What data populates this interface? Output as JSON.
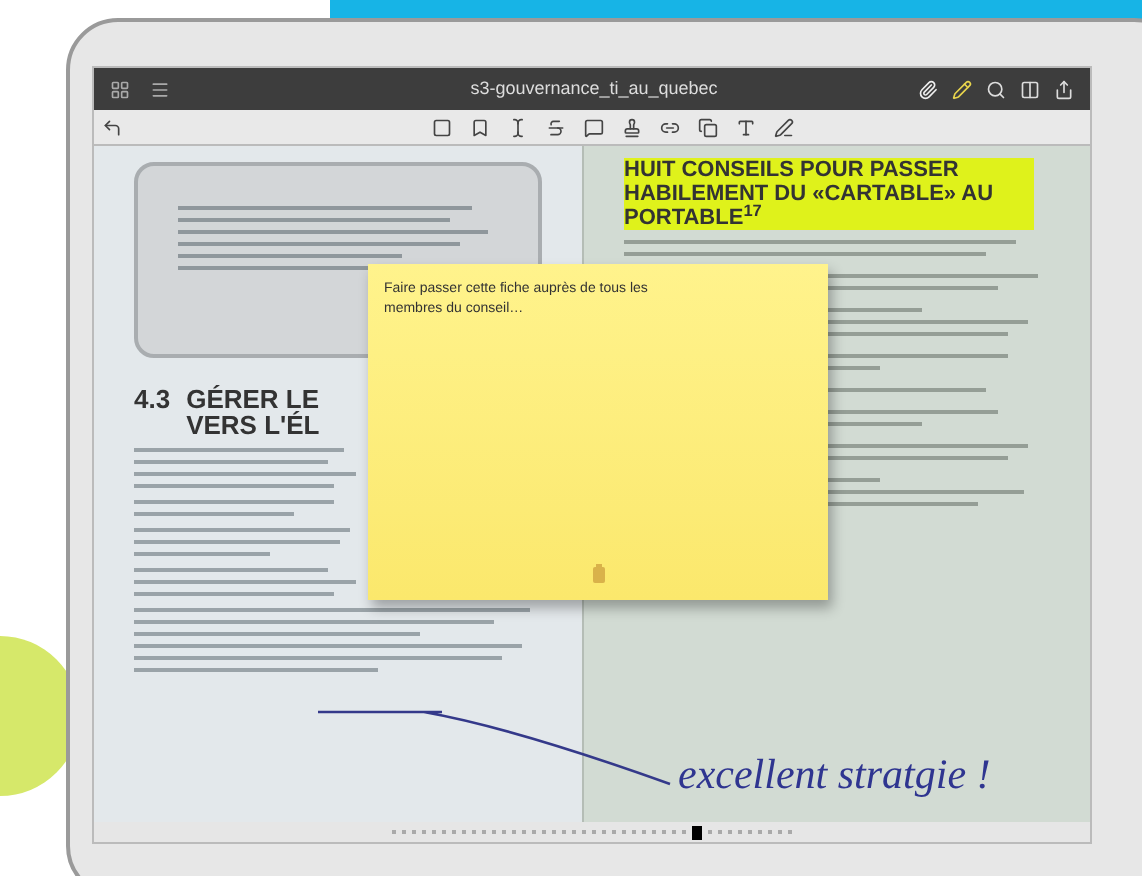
{
  "app_bar": {
    "title": "s3-gouvernance_ti_au_quebec"
  },
  "left_page": {
    "heading_number": "4.3",
    "heading_lines": [
      "GÉRER LE",
      "VERS L'ÉL"
    ]
  },
  "right_page": {
    "heading": "HUIT CONSEILS POUR PASSER HABILEMENT DU «CARTABLE» AU PORTABLE$^{17}$"
  },
  "sticky_note": {
    "text": "Faire passer cette fiche auprès de tous les membres du conseil…"
  },
  "handwritten_note": {
    "text": "excellent stratgie !"
  }
}
